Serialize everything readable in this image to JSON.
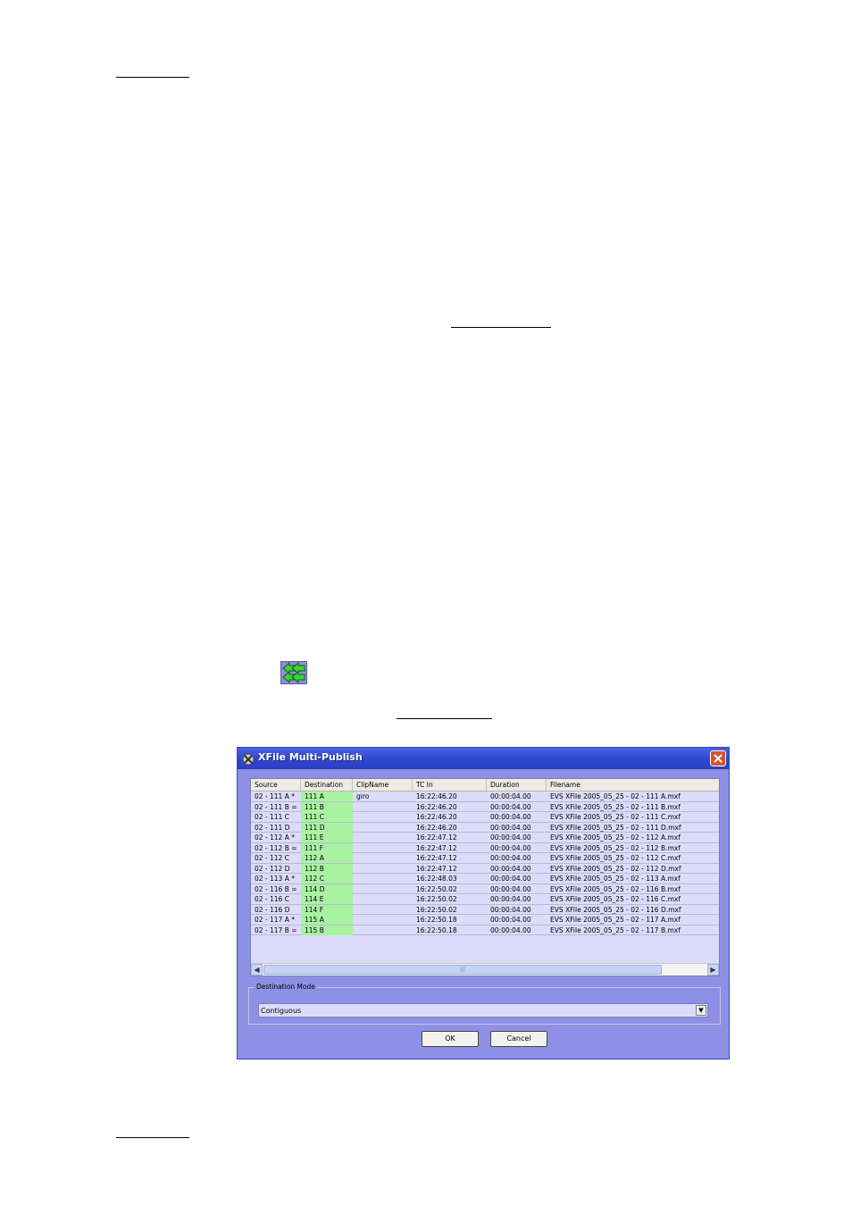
{
  "dialog": {
    "title": "XFile Multi-Publish",
    "columns": [
      "Source",
      "Destination",
      "ClipName",
      "TC In",
      "Duration",
      "Filename"
    ],
    "rows": [
      [
        "02 - 111 A *",
        "111 A",
        "giro",
        "16:22:46.20",
        "00:00:04.00",
        "EVS XFile 2005_05_25 - 02 - 111 A.mxf"
      ],
      [
        "02 - 111 B =",
        "111 B",
        "",
        "16:22:46.20",
        "00:00:04.00",
        "EVS XFile 2005_05_25 - 02 - 111 B.mxf"
      ],
      [
        "02 - 111 C",
        "111 C",
        "",
        "16:22:46.20",
        "00:00:04.00",
        "EVS XFile 2005_05_25 - 02 - 111 C.mxf"
      ],
      [
        "02 - 111 D",
        "111 D",
        "",
        "16:22:46.20",
        "00:00:04.00",
        "EVS XFile 2005_05_25 - 02 - 111 D.mxf"
      ],
      [
        "02 - 112 A *",
        "111 E",
        "",
        "16:22:47.12",
        "00:00:04.00",
        "EVS XFile 2005_05_25 - 02 - 112 A.mxf"
      ],
      [
        "02 - 112 B =",
        "111 F",
        "",
        "16:22:47.12",
        "00:00:04.00",
        "EVS XFile 2005_05_25 - 02 - 112 B.mxf"
      ],
      [
        "02 - 112 C",
        "112 A",
        "",
        "16:22:47.12",
        "00:00:04.00",
        "EVS XFile 2005_05_25 - 02 - 112 C.mxf"
      ],
      [
        "02 - 112 D",
        "112 B",
        "",
        "16:22:47.12",
        "00:00:04.00",
        "EVS XFile 2005_05_25 - 02 - 112 D.mxf"
      ],
      [
        "02 - 113 A *",
        "112 C",
        "",
        "16:22:48.03",
        "00:00:04.00",
        "EVS XFile 2005_05_25 - 02 - 113 A.mxf"
      ],
      [
        "02 - 116 B =",
        "114 D",
        "",
        "16:22:50.02",
        "00:00:04.00",
        "EVS XFile 2005_05_25 - 02 - 116 B.mxf"
      ],
      [
        "02 - 116 C",
        "114 E",
        "",
        "16:22:50.02",
        "00:00:04.00",
        "EVS XFile 2005_05_25 - 02 - 116 C.mxf"
      ],
      [
        "02 - 116 D",
        "114 F",
        "",
        "16:22:50.02",
        "00:00:04.00",
        "EVS XFile 2005_05_25 - 02 - 116 D.mxf"
      ],
      [
        "02 - 117 A *",
        "115 A",
        "",
        "16:22:50.18",
        "00:00:04.00",
        "EVS XFile 2005_05_25 - 02 - 117 A.mxf"
      ],
      [
        "02 - 117 B =",
        "115 B",
        "",
        "16:22:50.18",
        "00:00:04.00",
        "EVS XFile 2005_05_25 - 02 - 117 B.mxf"
      ]
    ],
    "destination_mode": {
      "legend": "Destination Mode",
      "value": "Contiguous"
    },
    "ok_label": "OK",
    "cancel_label": "Cancel"
  },
  "icons": {
    "publish": "multi-publish-arrows-icon",
    "app": "xfile-app-icon",
    "close": "close-icon"
  },
  "colors": {
    "dialog_body": "#8e90e6",
    "titlebar": "#2f45cf",
    "destination_cell": "#a9f2a2",
    "list_background": "#dcdcfa"
  }
}
